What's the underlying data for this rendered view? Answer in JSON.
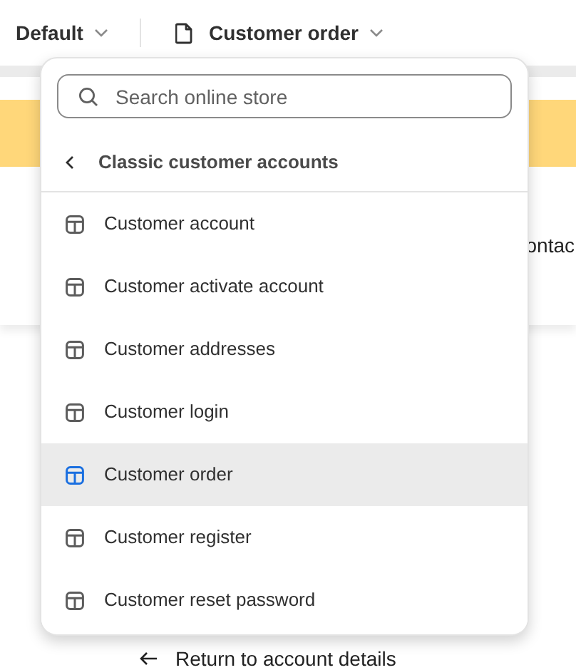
{
  "top_bar": {
    "theme_selector": "Default",
    "template_selector": "Customer order"
  },
  "background": {
    "partial_text": "ontac",
    "return_link": "Return to account details"
  },
  "dropdown": {
    "search": {
      "placeholder": "Search online store"
    },
    "header": "Classic customer accounts",
    "items": [
      {
        "label": "Customer account",
        "selected": false
      },
      {
        "label": "Customer activate account",
        "selected": false
      },
      {
        "label": "Customer addresses",
        "selected": false
      },
      {
        "label": "Customer login",
        "selected": false
      },
      {
        "label": "Customer order",
        "selected": true
      },
      {
        "label": "Customer register",
        "selected": false
      },
      {
        "label": "Customer reset password",
        "selected": false
      }
    ]
  }
}
